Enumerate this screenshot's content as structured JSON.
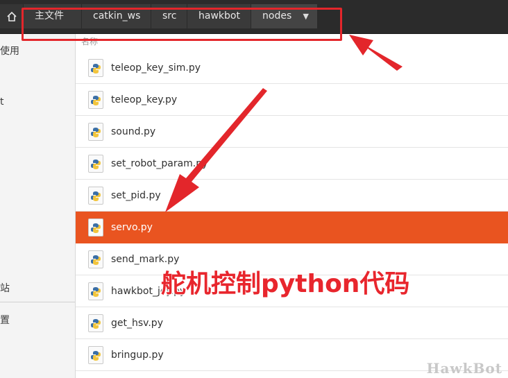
{
  "breadcrumb": {
    "home_icon": "home-icon",
    "items": [
      "主文件夹",
      "catkin_ws",
      "src",
      "hawkbot",
      "nodes"
    ],
    "dropdown_icon": "caret-down-icon"
  },
  "sidebar": {
    "items": [
      "使用",
      "t",
      "站",
      "置"
    ]
  },
  "file_list": {
    "column_header": "名称",
    "files": [
      "teleop_key_sim.py",
      "teleop_key.py",
      "sound.py",
      "set_robot_param.py",
      "set_pid.py",
      "servo.py",
      "send_mark.py",
      "hawkbot_joy.py",
      "get_hsv.py",
      "bringup.py"
    ],
    "file_icon": "python-file-icon",
    "selected": "servo.py"
  },
  "annotation": {
    "text": "舵机控制python代码",
    "color": "#e8262d"
  },
  "watermark": "HawkBot",
  "colors": {
    "selection": "#e95420",
    "header_bg": "#2b2b2b",
    "annotation_red": "#e3262b"
  }
}
